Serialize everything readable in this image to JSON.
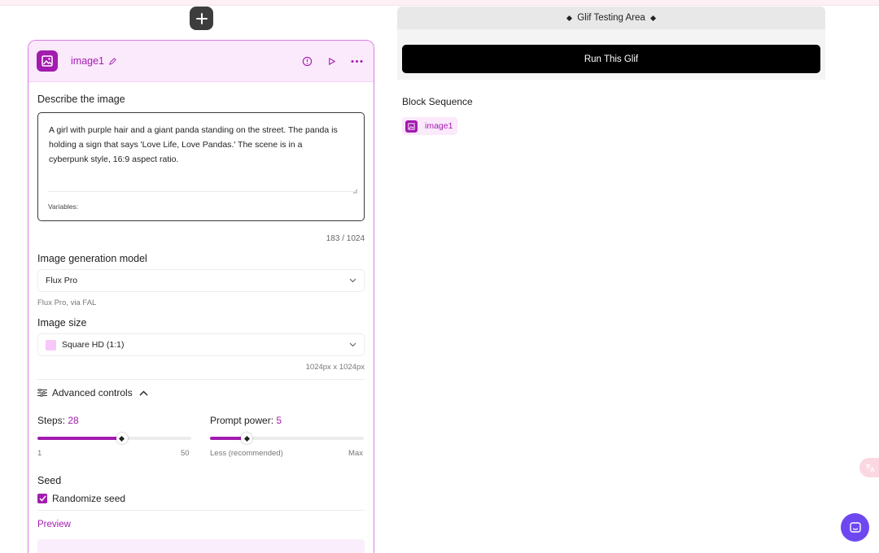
{
  "block": {
    "name": "image1",
    "icon": "image-block-icon",
    "accent": "#a21caf"
  },
  "prompt": {
    "label": "Describe the image",
    "text": "A girl with purple hair and a giant panda standing on the street. The panda is holding a sign that says 'Love Life, Love Pandas.' The scene is in a cyberpunk style, 16:9 aspect ratio.",
    "variables_label": "Variables:",
    "counter": "183 / 1024"
  },
  "model": {
    "label": "Image generation model",
    "selected": "Flux Pro",
    "hint": "Flux Pro, via FAL"
  },
  "size": {
    "label": "Image size",
    "selected": "Square HD (1:1)",
    "hint": "1024px x 1024px"
  },
  "advanced": {
    "label": "Advanced controls",
    "steps": {
      "label": "Steps:",
      "value": "28",
      "min": "1",
      "max": "50",
      "fraction": 0.55
    },
    "prompt_power": {
      "label": "Prompt power:",
      "value": "5",
      "min_label": "Less (recommended)",
      "max_label": "Max",
      "fraction": 0.24
    }
  },
  "seed": {
    "label": "Seed",
    "randomize_label": "Randomize seed",
    "randomize_checked": true
  },
  "preview": {
    "label": "Preview"
  },
  "testing": {
    "title": "Glif Testing Area",
    "run_label": "Run This Glif"
  },
  "sequence": {
    "label": "Block Sequence",
    "items": [
      "image1"
    ]
  },
  "colors": {
    "accent": "#a21caf",
    "header_bg": "#fbe9fc",
    "run_button": "#000000",
    "chat_fab": "#6d48f0"
  }
}
